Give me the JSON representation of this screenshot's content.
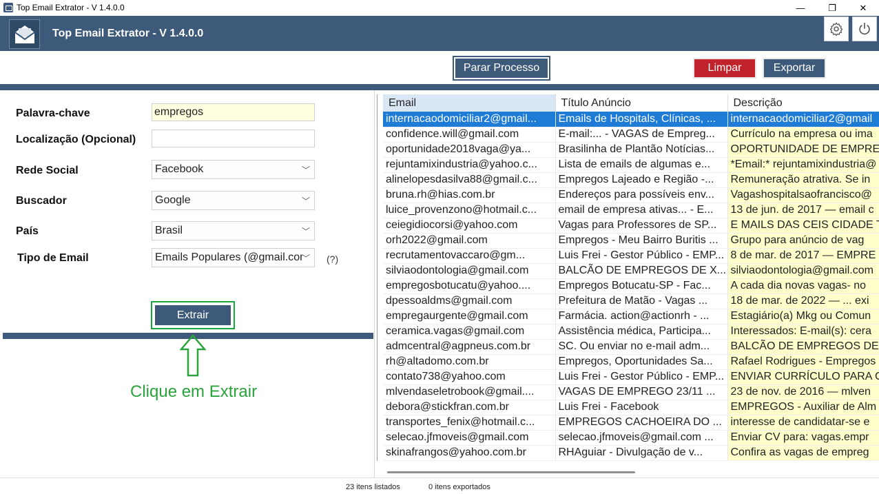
{
  "window": {
    "title": "Top Email Extrator - V 1.4.0.0",
    "minimize": "—",
    "maximize": "❐",
    "close": "✕"
  },
  "header": {
    "title": "Top Email Extrator - V 1.4.0.0",
    "logo_icon": "envelope-icon",
    "settings_icon": "gear-icon",
    "power_icon": "power-icon"
  },
  "toolbar": {
    "stop_label": "Parar Processo",
    "clear_label": "Limpar",
    "export_label": "Exportar"
  },
  "form": {
    "keyword_label": "Palavra-chave",
    "keyword_value": "empregos",
    "location_label": "Localização (Opcional)",
    "location_value": "",
    "social_label": "Rede Social",
    "social_value": "Facebook",
    "search_label": "Buscador",
    "search_value": "Google",
    "country_label": "País",
    "country_value": "Brasil",
    "email_type_label": "Tipo de Email",
    "email_type_value": "Emails Populares (@gmail.com",
    "help_label": "(?)",
    "extract_label": "Extrair",
    "hint": "Clique em Extrair"
  },
  "table": {
    "columns": [
      "Email",
      "Título Anúncio",
      "Descrição"
    ],
    "rows": [
      [
        "internacaodomiciliar2@gmail...",
        "Emails de Hospitals, Clínicas, ...",
        "internacaodomiciliar2@gmail"
      ],
      [
        "confidence.will@gmail.com",
        "E-mail:... - VAGAS de Empreg...",
        "Currículo na empresa ou ima"
      ],
      [
        "oportunidade2018vaga@ya...",
        "Brasilinha de Plantão Notícias...",
        "OPORTUNIDADE DE EMPREGO"
      ],
      [
        "rejuntamixindustria@yahoo.c...",
        "Lista de emails de algumas e...",
        "*Email:* rejuntamixindustria@"
      ],
      [
        "alinelopesdasilva88@gmail.c...",
        "Empregos Lajeado e Região -...",
        "Remuneração atrativa. Se in"
      ],
      [
        "bruna.rh@hias.com.br",
        "Endereços para possíveis env...",
        "Vagashospitalsaofrancisco@"
      ],
      [
        "luice_provenzono@hotmail.c...",
        "email de empresa ativas... - E...",
        "13 de jun. de 2017 — email c"
      ],
      [
        "ceiegidiocorsi@yahoo.com",
        "Vagas para Professores de SP...",
        "E MAILS DAS CEIS CIDADE T"
      ],
      [
        "orh2022@gmail.com",
        "Empregos - Meu Bairro Buritis ...",
        "Grupo para anúncio de vag"
      ],
      [
        "recrutamentovaccaro@gm...",
        "Luis Frei - Gestor Público - EMP...",
        "8 de mar. de 2017 — EMPRE"
      ],
      [
        "silviaodontologia@gmail.com",
        "BALCÃO DE EMPREGOS DE X...",
        "silviaodontologia@gmail.com"
      ],
      [
        "empregosbotucatu@yahoo....",
        "Empregos Botucatu-SP - Fac...",
        "A cada dia novas vagas- no"
      ],
      [
        "dpessoaldms@gmail.com",
        "Prefeitura de Matão - Vagas ...",
        "18 de mar. de 2022 — ... exi"
      ],
      [
        "empregaurgente@gmail.com",
        "Farmácia. action@actionrh - ...",
        "Estagiário(a) Mkg ou Comun"
      ],
      [
        "ceramica.vagas@gmail.com",
        "Assistência médica, Participa...",
        "Interessados: E-mail(s): cera"
      ],
      [
        "admcentral@agpneus.com.br",
        "SC. Ou enviar no e-mail adm...",
        "BALCÃO DE EMPREGOS DE"
      ],
      [
        "rh@altadomo.com.br",
        "Empregos, Oportunidades Sa...",
        "Rafael Rodrigues - Empregos"
      ],
      [
        "contato738@yahoo.com",
        "Luis Frei - Gestor Público - EMP...",
        "ENVIAR CURRÍCULO PARA C"
      ],
      [
        "mlvendaseletrobook@gmail....",
        "VAGAS DE EMPREGO 23/11 ...",
        "23 de nov. de 2016 — mlven"
      ],
      [
        "debora@stickfran.com.br",
        "Luis Frei - Facebook",
        "EMPREGOS - Auxiliar de Alm"
      ],
      [
        "transportes_fenix@hotmail.c...",
        "EMPREGOS CACHOEIRA DO ...",
        "interesse de candidatar-se e"
      ],
      [
        "selecao.jfmoveis@gmail.com",
        "selecao.jfmoveis@gmail.com ...",
        "Enviar CV para: vagas.empr"
      ],
      [
        "skinafrangos@yahoo.com.br",
        "RHAguiar - Divulgação de v...",
        "Confira as vagas de empreg"
      ]
    ]
  },
  "status": {
    "listed": "23 itens listados",
    "exported": "0  itens exportados"
  }
}
